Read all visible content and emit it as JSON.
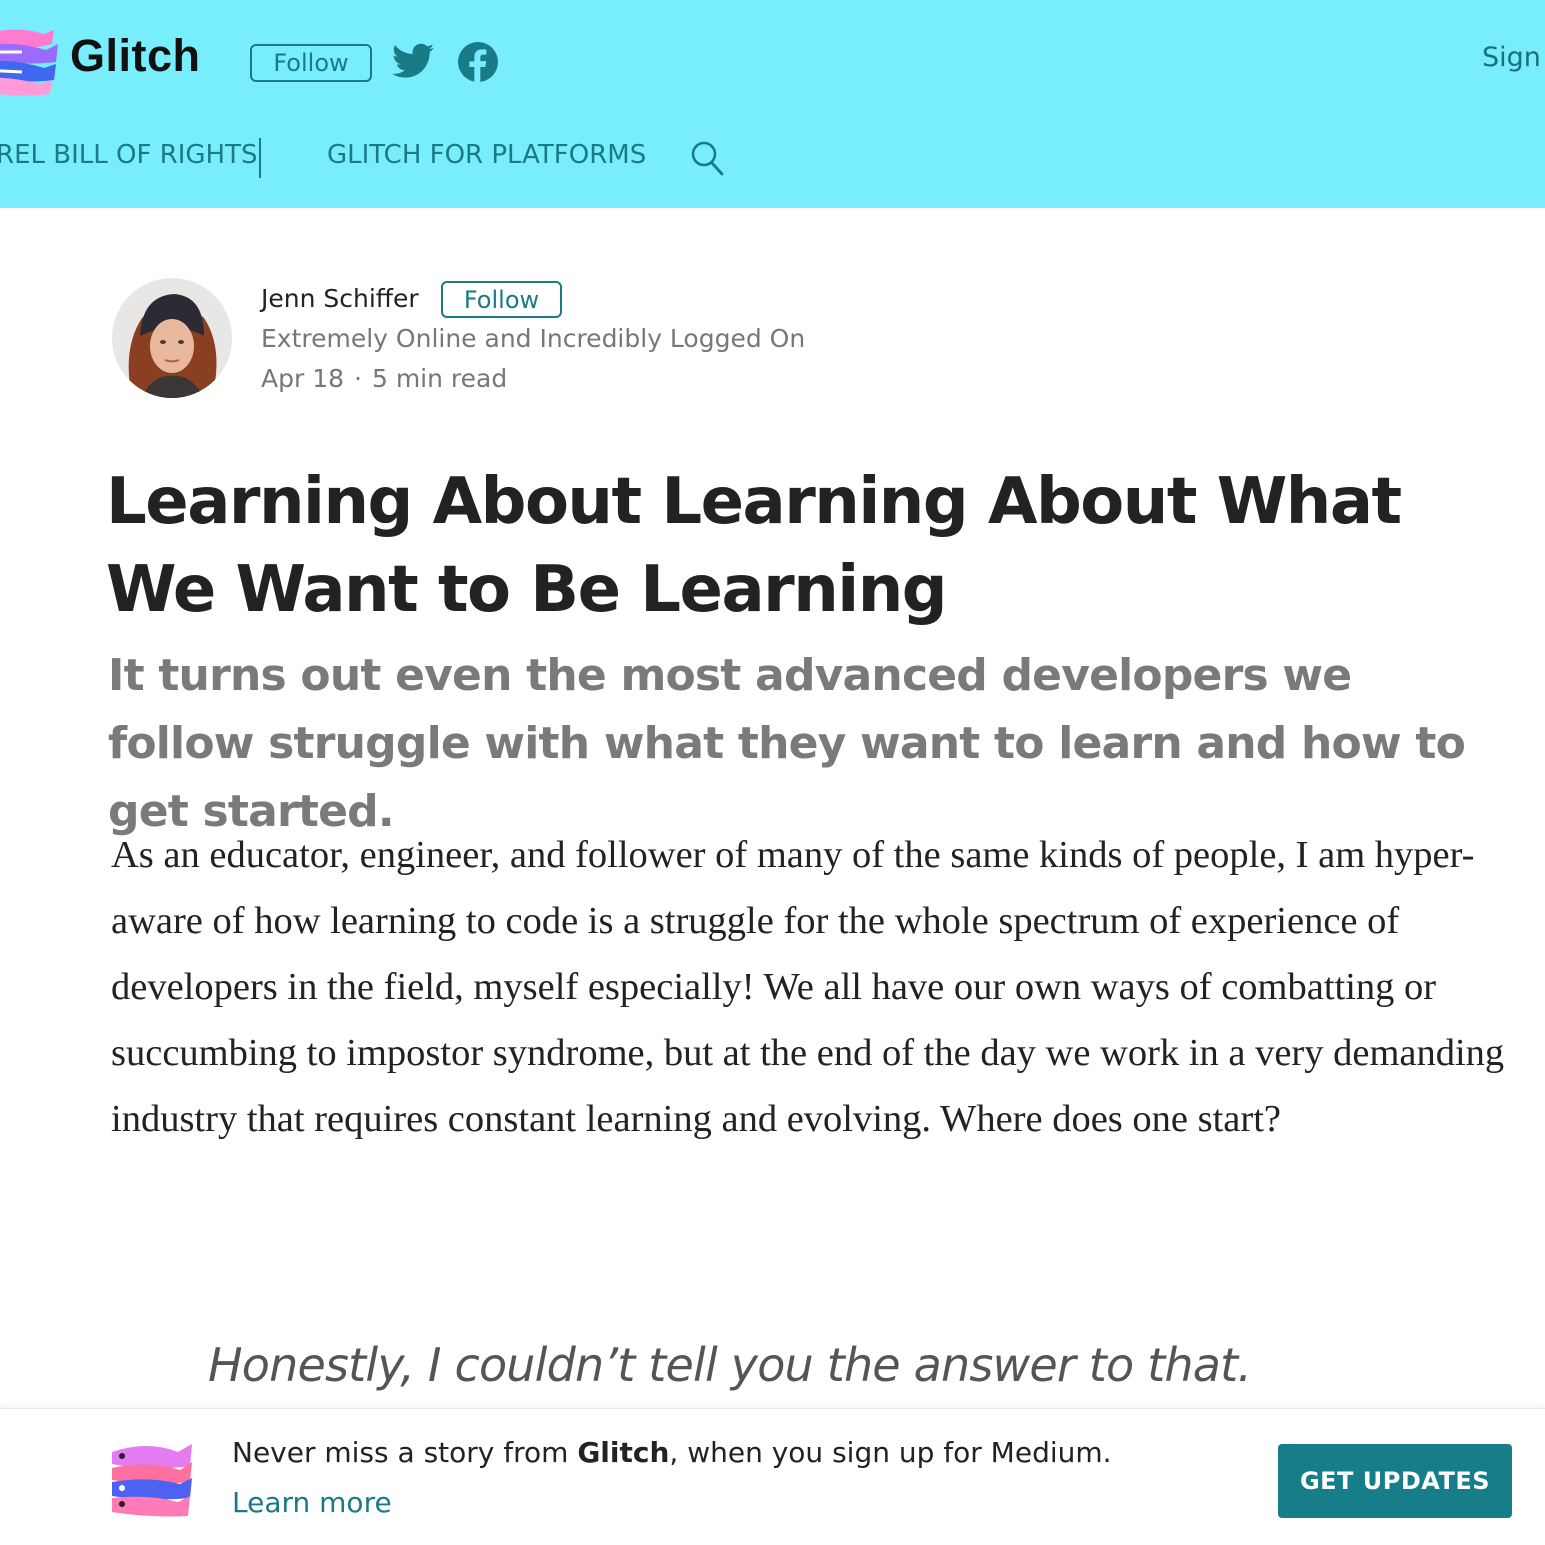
{
  "header": {
    "brand": "Glitch",
    "follow_label": "Follow",
    "sign_label": "Sign",
    "nav": [
      "REL BILL OF RIGHTS",
      "GLITCH FOR PLATFORMS"
    ],
    "icons": [
      "glitch-fish-logo-icon",
      "twitter-icon",
      "facebook-icon",
      "search-icon"
    ],
    "colors": {
      "background": "#78edfb",
      "accent": "#1a7a86"
    }
  },
  "author": {
    "name": "Jenn Schiffer",
    "follow_label": "Follow",
    "bio": "Extremely Online and Incredibly Logged On",
    "date": "Apr 18",
    "separator": "·",
    "read_time": "5 min read"
  },
  "article": {
    "title": "Learning About Learning About What We Want to Be Learning",
    "subtitle": "It turns out even the most advanced developers we follow struggle with what they want to learn and how to get started.",
    "paragraph": "As an educator, engineer, and follower of many of the same kinds of people, I am hyper-aware of how learning to code is a struggle for the whole spectrum of experience of developers in the field, myself especially! We all have our own ways of combatting or succumbing to impostor syndrome, but at the end of the day we work in a very demanding industry that requires constant learning and evolving. Where does one start?",
    "pullquote": "Honestly, I couldn’t tell you the answer to that."
  },
  "banner": {
    "text_before": "Never miss a story from ",
    "publication": "Glitch",
    "text_after": ", when you sign up for Medium.",
    "learn_more": "Learn more",
    "cta": "GET UPDATES",
    "cta_color": "#177e89"
  }
}
